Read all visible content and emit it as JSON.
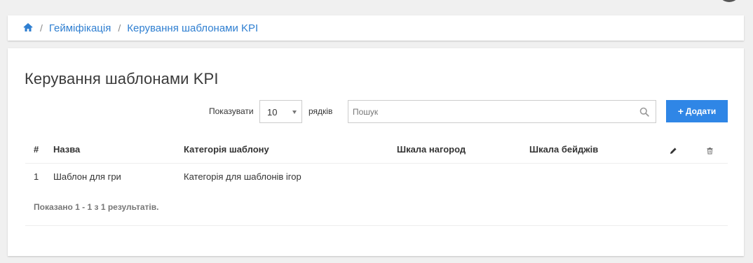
{
  "breadcrumb": {
    "home_icon": "home-icon",
    "items": [
      "Гейміфікація",
      "Керування шаблонами KPI"
    ],
    "separator": "/"
  },
  "page": {
    "title": "Керування шаблонами KPI"
  },
  "toolbar": {
    "show_label": "Показувати",
    "page_size": "10",
    "rows_label": "рядків",
    "search_placeholder": "Пошук",
    "add_label": "Додати"
  },
  "table": {
    "headers": {
      "number": "#",
      "name": "Назва",
      "category": "Категорія шаблону",
      "reward_scale": "Шкала нагород",
      "badge_scale": "Шкала бейджів",
      "edit_icon": "pencil-icon",
      "delete_icon": "trash-icon"
    },
    "rows": [
      {
        "number": "1",
        "name": "Шаблон для гри",
        "category": "Категорія для шаблонів ігор",
        "reward_scale": "",
        "badge_scale": ""
      }
    ]
  },
  "footer": {
    "results_text": "Показано 1 - 1 з 1 результатів."
  },
  "colors": {
    "accent": "#2f86e6",
    "link": "#2f7fd1",
    "background": "#f0f0f0"
  }
}
